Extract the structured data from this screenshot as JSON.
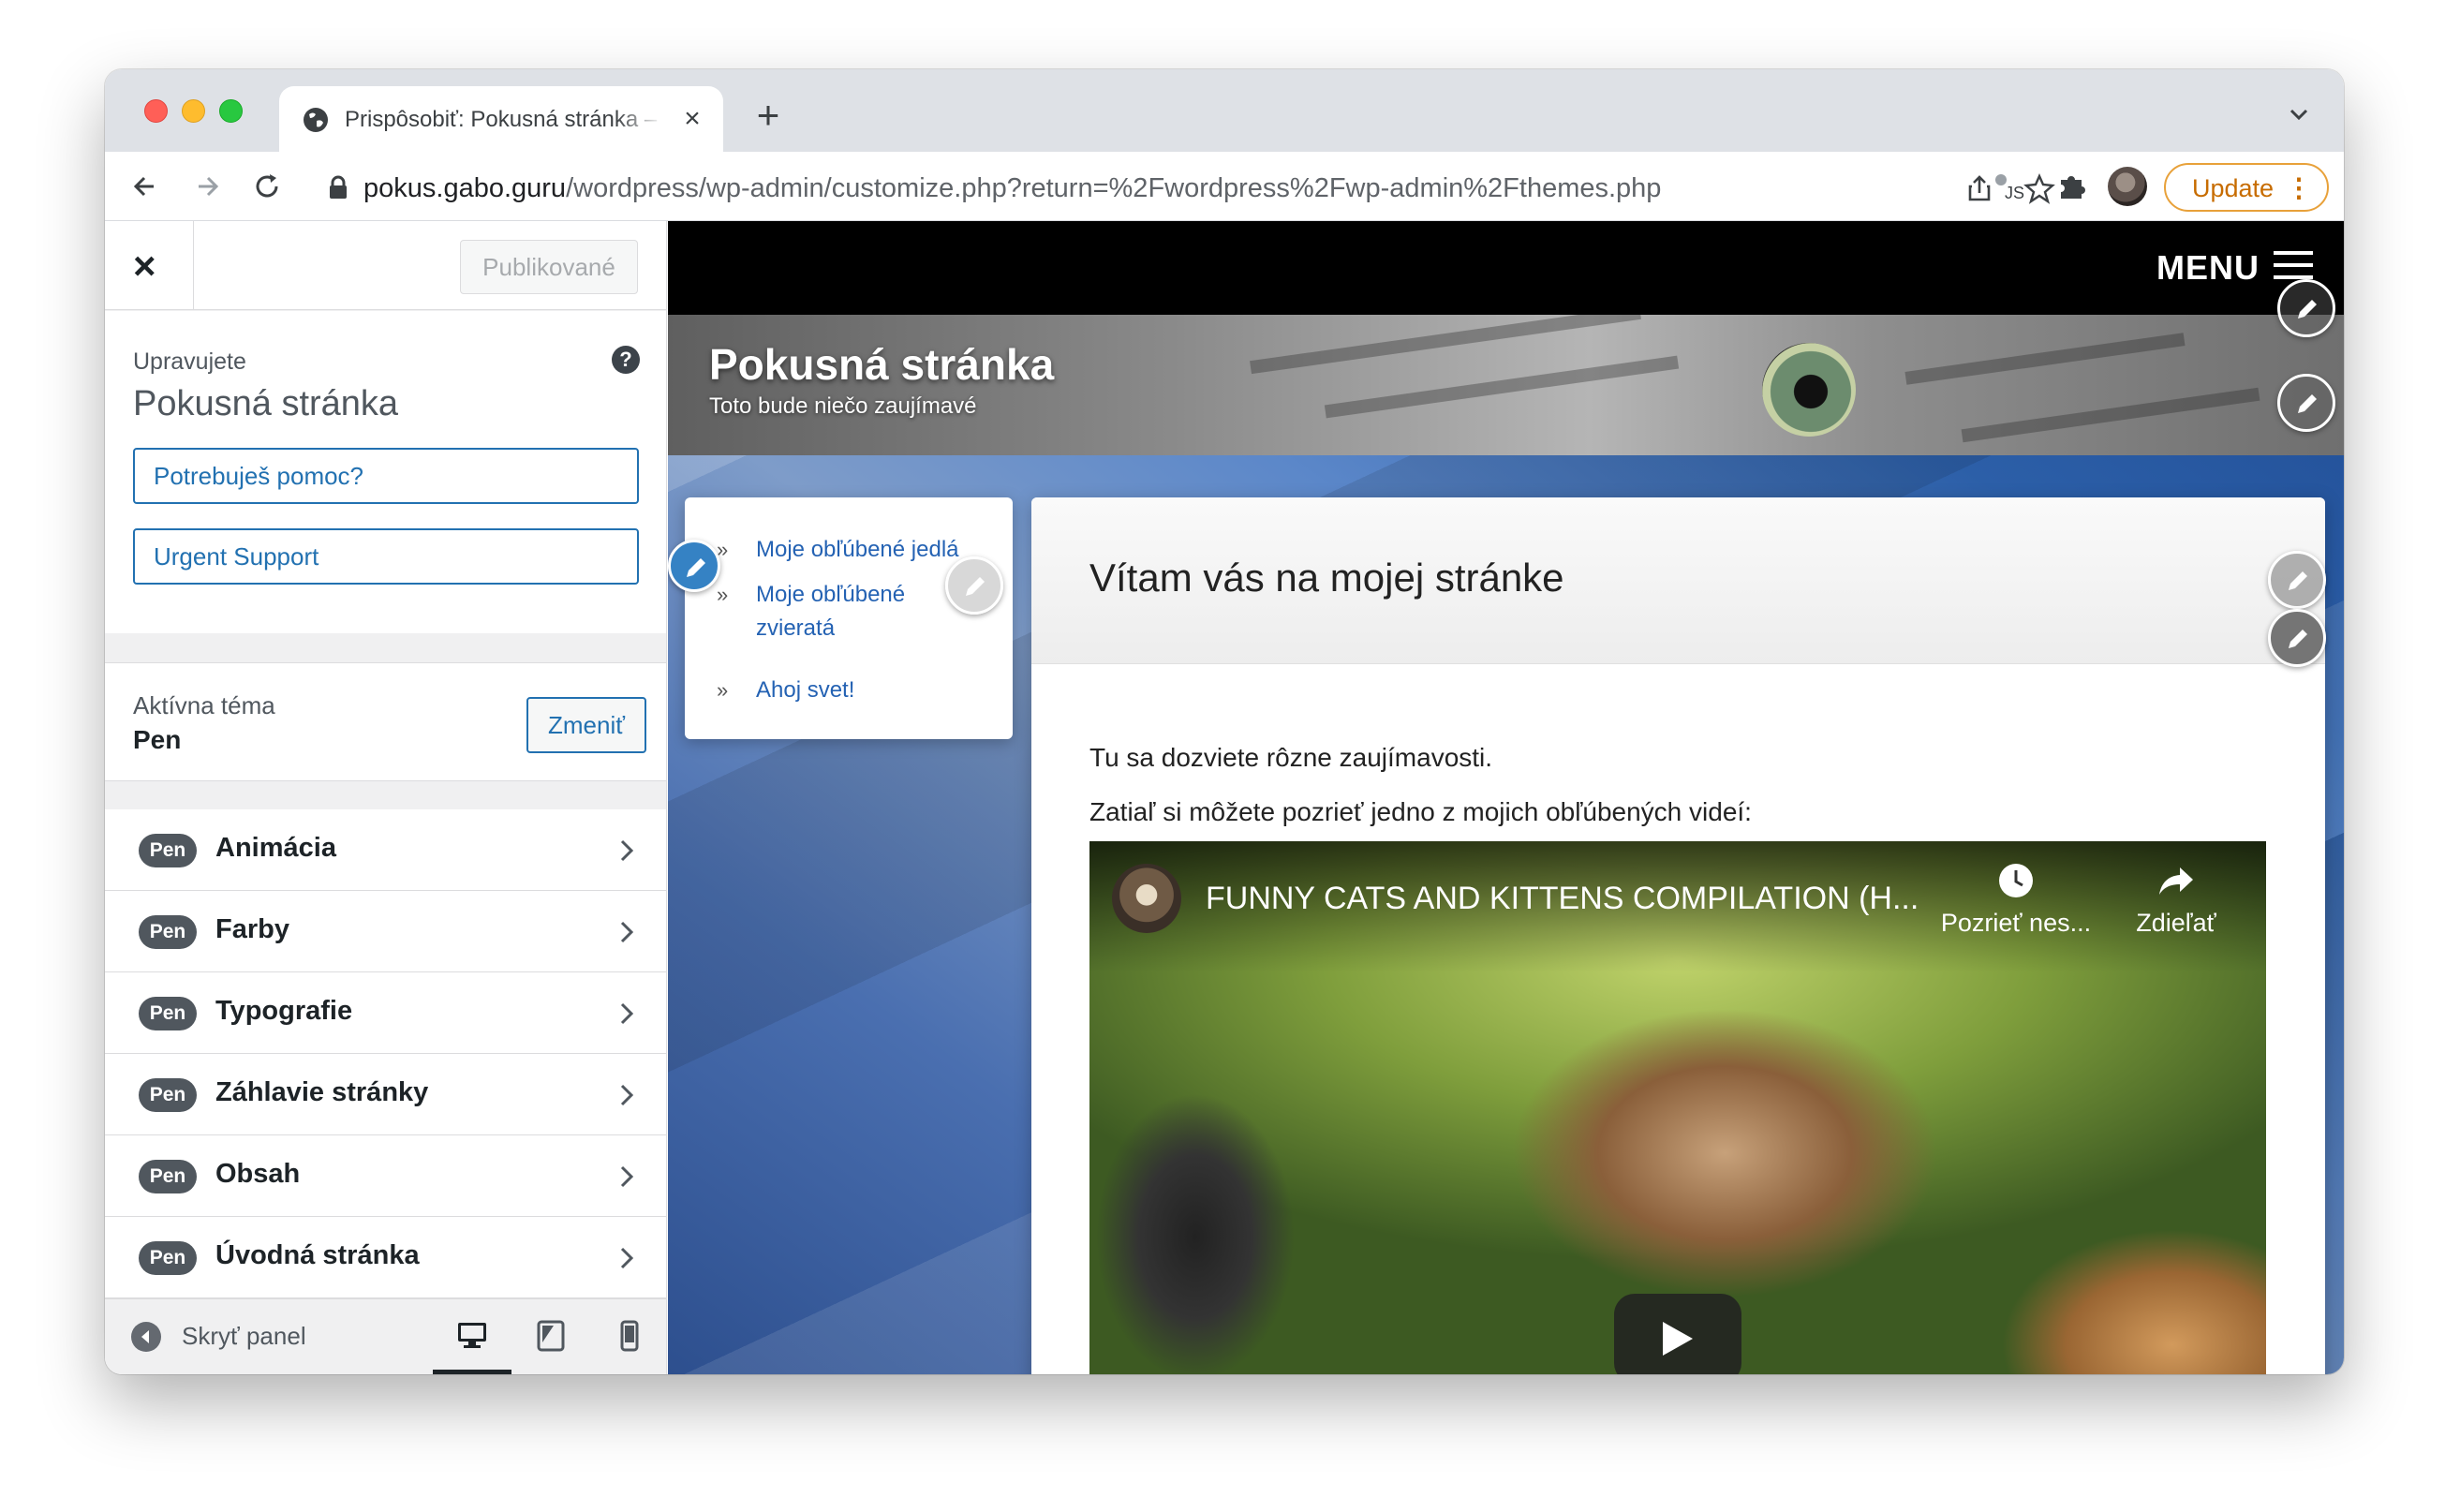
{
  "browser": {
    "tab_title": "Prispôsobiť: Pokusná stránka – ...",
    "url_host": "pokus.gabo.guru",
    "url_path": "/wordpress/wp-admin/customize.php?return=%2Fwordpress%2Fwp-admin%2Fthemes.php",
    "update_label": "Update",
    "icons": [
      "back-icon",
      "forward-icon",
      "reload-icon",
      "lock-icon",
      "share-icon",
      "star-icon",
      "extension-js-icon",
      "puzzle-icon",
      "profile-avatar",
      "kebab-icon"
    ]
  },
  "sidebar": {
    "close_label": "×",
    "publish_label": "Publikované",
    "editing_label": "Upravujete",
    "site_name": "Pokusná stránka",
    "help_label": "?",
    "links": [
      "Potrebuješ pomoc?",
      "Urgent Support"
    ],
    "theme": {
      "label": "Aktívna téma",
      "name": "Pen",
      "change_label": "Zmeniť"
    },
    "sections": [
      {
        "badge": "Pen",
        "label": "Animácia"
      },
      {
        "badge": "Pen",
        "label": "Farby"
      },
      {
        "badge": "Pen",
        "label": "Typografie"
      },
      {
        "badge": "Pen",
        "label": "Záhlavie stránky"
      },
      {
        "badge": "Pen",
        "label": "Obsah"
      },
      {
        "badge": "Pen",
        "label": "Úvodná stránka"
      }
    ],
    "footer": {
      "collapse_label": "Skryť panel",
      "active_device": "desktop"
    }
  },
  "preview": {
    "menu_label": "MENU",
    "site_title": "Pokusná stránka",
    "tagline": "Toto bude niečo zaujímavé",
    "menu_items": [
      {
        "arrow": "»",
        "label": "Moje obľúbené jedlá"
      },
      {
        "arrow": "»",
        "label": "Moje obľúbené zvieratá"
      },
      {
        "arrow": "»",
        "label": "Ahoj svet!"
      }
    ],
    "post": {
      "title": "Vítam vás na mojej stránke",
      "paragraph_1": "Tu sa dozviete rôzne zaujímavosti.",
      "paragraph_2": "Zatiaľ si môžete pozrieť jedno z mojich obľúbených videí:"
    },
    "video": {
      "title": "FUNNY CATS AND KITTENS COMPILATION (H...",
      "watch_later_label": "Pozrieť nes...",
      "share_label": "Zdieľať"
    }
  },
  "colors": {
    "wp_blue": "#2271b1",
    "update_accent": "#c76c00",
    "badge_gray": "#50575e"
  }
}
